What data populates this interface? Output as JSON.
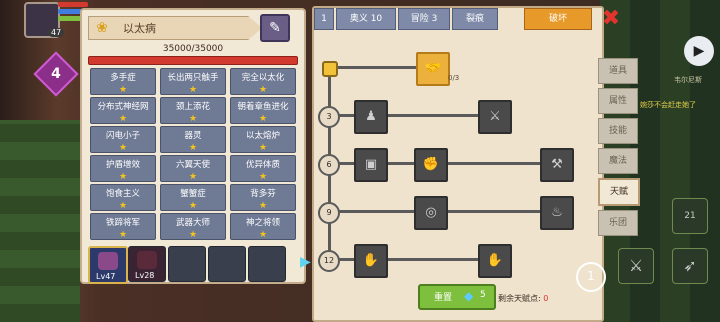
{
  "hud": {
    "level": "47",
    "zone_badge": "4",
    "bars": [
      "#d23a2f",
      "#3f7ee0",
      "#7fbf3e"
    ]
  },
  "left_panel": {
    "title": "以太病",
    "hp": "35000/35000",
    "skills": [
      [
        "多手症",
        "长出两只触手",
        "完全以太化"
      ],
      [
        "分布式神经网",
        "颈上添花",
        "朝着章鱼进化"
      ],
      [
        "闪电小子",
        "器灵",
        "以太熔炉"
      ],
      [
        "护盾增效",
        "六翼天使",
        "优异体质"
      ],
      [
        "饱食主义",
        "蟹蟹症",
        "背多芬"
      ],
      [
        "铁蹄将军",
        "武器大师",
        "神之将领"
      ]
    ],
    "star": "★",
    "pets": [
      {
        "lv": "Lv47"
      },
      {
        "lv": "Lv28"
      }
    ],
    "next_arrow": "▶"
  },
  "right_panel": {
    "tabs": [
      "1",
      "奥义 10",
      "冒险 3",
      "裂痕",
      "破坏"
    ],
    "active_tab": "破坏",
    "close": "✖",
    "levels": [
      "3",
      "6",
      "9",
      "12"
    ],
    "root_node_count": "0/3",
    "reset_label": "重置",
    "reset_cost": "5",
    "remaining_label": "剩余天赋点:",
    "remaining_value": "0"
  },
  "side_menu": {
    "items": [
      "道具",
      "属性",
      "技能",
      "魔法",
      "天赋",
      "乐团"
    ],
    "active": "天赋"
  },
  "right_hud": {
    "npc_name": "韦尔尼斯",
    "dialog": "婉莎不会赶走她了",
    "play": "▶",
    "crosshair": "1",
    "ammo": "21"
  }
}
